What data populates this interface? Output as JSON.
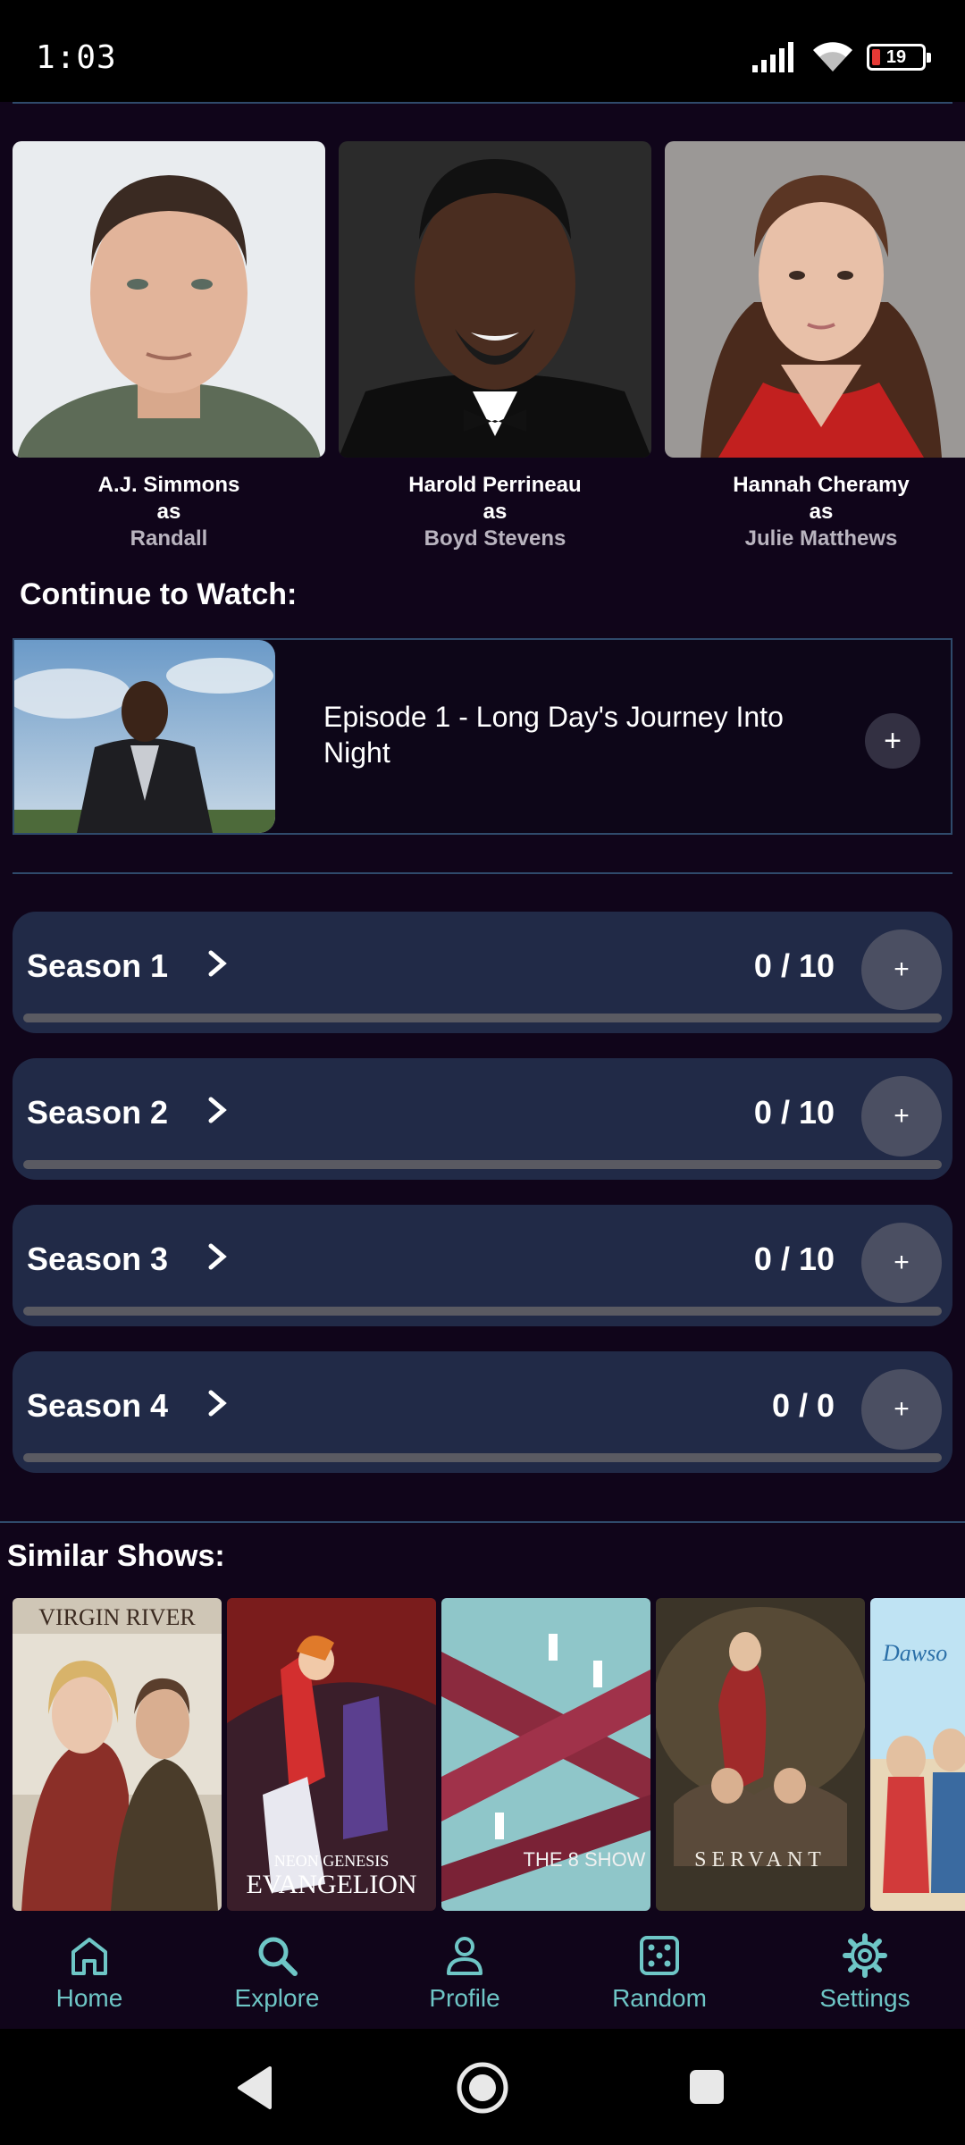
{
  "status_bar": {
    "time": "1:03",
    "battery": "19"
  },
  "cast": [
    {
      "name": "A.J. Simmons",
      "as": "as",
      "role": "Randall"
    },
    {
      "name": "Harold Perrineau",
      "as": "as",
      "role": "Boyd Stevens"
    },
    {
      "name": "Hannah Cheramy",
      "as": "as",
      "role": "Julie Matthews"
    }
  ],
  "continue_watch": {
    "heading": "Continue to Watch:",
    "episode_title": "Episode 1 - Long Day's Journey Into Night",
    "add_label": "+"
  },
  "seasons": [
    {
      "title": "Season 1",
      "count": "0 / 10",
      "progress": 0,
      "add_label": "+"
    },
    {
      "title": "Season 2",
      "count": "0 / 10",
      "progress": 0,
      "add_label": "+"
    },
    {
      "title": "Season 3",
      "count": "0 / 10",
      "progress": 0,
      "add_label": "+"
    },
    {
      "title": "Season 4",
      "count": "0 / 0",
      "progress": 0,
      "add_label": "+"
    }
  ],
  "similar": {
    "heading": "Similar Shows:",
    "posters": [
      {
        "text": "VIRGIN RIVER"
      },
      {
        "text": "NEON GENESIS",
        "text2": "EVANGELION"
      },
      {
        "text": "THE 8 SHOW"
      },
      {
        "text": "SERVANT"
      },
      {
        "text": "Dawso"
      }
    ]
  },
  "bottom_nav": [
    {
      "label": "Home",
      "icon": "home-icon"
    },
    {
      "label": "Explore",
      "icon": "search-icon"
    },
    {
      "label": "Profile",
      "icon": "profile-icon"
    },
    {
      "label": "Random",
      "icon": "dice-icon"
    },
    {
      "label": "Settings",
      "icon": "gear-icon"
    }
  ],
  "colors": {
    "accent": "#6ec6c6",
    "background": "#10051a",
    "card": "#212a47",
    "divider": "#2f4a6b"
  }
}
